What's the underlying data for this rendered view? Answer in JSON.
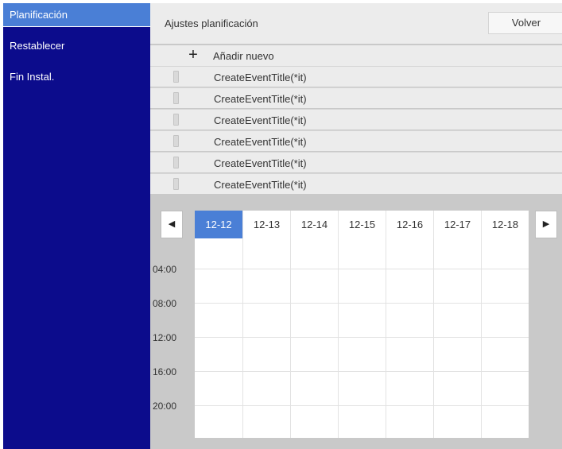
{
  "sidebar": {
    "items": [
      {
        "label": "Planificación",
        "active": true
      },
      {
        "label": "Restablecer",
        "active": false
      },
      {
        "label": "Fin Instal.",
        "active": false
      }
    ]
  },
  "header": {
    "title": "Ajustes planificación",
    "back_label": "Volver"
  },
  "list": {
    "add_label": "Añadir nuevo",
    "events": [
      {
        "title": "CreateEventTitle(*it)"
      },
      {
        "title": "CreateEventTitle(*it)"
      },
      {
        "title": "CreateEventTitle(*it)"
      },
      {
        "title": "CreateEventTitle(*it)"
      },
      {
        "title": "CreateEventTitle(*it)"
      },
      {
        "title": "CreateEventTitle(*it)"
      }
    ]
  },
  "calendar": {
    "days": [
      "12-12",
      "12-13",
      "12-14",
      "12-15",
      "12-16",
      "12-17",
      "12-18"
    ],
    "selected_day": "12-12",
    "times": [
      "04:00",
      "08:00",
      "12:00",
      "16:00",
      "20:00"
    ],
    "prev_icon": "triangle-left-icon",
    "next_icon": "triangle-right-icon"
  },
  "colors": {
    "sidebar_bg": "#0c0c8c",
    "accent": "#4a7fd6",
    "panel_bg": "#ececec",
    "frame_bg": "#c9c9c9"
  }
}
